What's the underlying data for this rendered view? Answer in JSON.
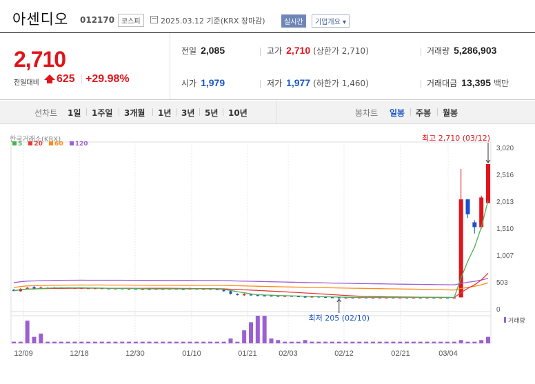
{
  "header": {
    "name": "아센디오",
    "code": "012170",
    "market": "코스피",
    "base_date": "2025.03.12  기준(KRX 장마감)",
    "realtime_label": "실시간",
    "corp_label": "기업개요 ▾"
  },
  "summary": {
    "price": "2,710",
    "change_label": "전일대비",
    "change_amount": "625",
    "change_pct": "+29.98%",
    "prev_close_label": "전일",
    "prev_close": "2,085",
    "high_label": "고가",
    "high": "2,710",
    "upper_limit": "(상한가 2,710)",
    "volume_label": "거래량",
    "volume": "5,286,903",
    "open_label": "시가",
    "open": "1,979",
    "low_label": "저가",
    "low": "1,977",
    "lower_limit": "(하한가 1,460)",
    "amount_label": "거래대금",
    "amount": "13,395",
    "amount_unit": "백만"
  },
  "period_bar": {
    "line_label": "선차트",
    "line_periods": [
      "1일",
      "1주일",
      "3개월",
      "1년",
      "3년",
      "5년",
      "10년"
    ],
    "candle_label": "봉차트",
    "candle_periods": [
      "일봉",
      "주봉",
      "월봉"
    ]
  },
  "colors": {
    "up": "#e0151b",
    "down": "#1a54c8",
    "ma5": "#4caf50",
    "ma20": "#e53935",
    "ma60": "#ff8c1a",
    "ma120": "#9c5fd1"
  },
  "chart_data": {
    "type": "candlestick",
    "source": "한국거래소(KRX)",
    "legend": [
      {
        "name": "5",
        "color": "#4caf50"
      },
      {
        "name": "20",
        "color": "#e53935"
      },
      {
        "name": "60",
        "color": "#ff8c1a"
      },
      {
        "name": "120",
        "color": "#9c5fd1"
      }
    ],
    "price_ticks": [
      "3,020",
      "2,516",
      "2,013",
      "1,510",
      "1,007",
      "503",
      "0"
    ],
    "ylim": [
      0,
      3020
    ],
    "x_ticks": [
      "12/09",
      "12/18",
      "12/30",
      "01/10",
      "01/21",
      "02/03",
      "02/12",
      "02/21",
      "03/04"
    ],
    "max_annotation": "최고 2,710 (03/12)",
    "min_annotation": "최저 205 (02/10)",
    "volume_label": "거래량",
    "candles": [
      {
        "o": 355,
        "c": 340,
        "h": 375,
        "l": 330
      },
      {
        "o": 330,
        "c": 375,
        "h": 385,
        "l": 320
      },
      {
        "o": 380,
        "c": 395,
        "h": 410,
        "l": 370
      },
      {
        "o": 410,
        "c": 380,
        "h": 440,
        "l": 370
      },
      {
        "o": 395,
        "c": 400,
        "h": 420,
        "l": 390
      },
      {
        "o": 395,
        "c": 385,
        "h": 405,
        "l": 375
      },
      {
        "o": 395,
        "c": 400,
        "h": 410,
        "l": 385
      },
      {
        "o": 400,
        "c": 395,
        "h": 410,
        "l": 390
      },
      {
        "o": 400,
        "c": 395,
        "h": 405,
        "l": 390
      },
      {
        "o": 395,
        "c": 390,
        "h": 400,
        "l": 385
      },
      {
        "o": 385,
        "c": 395,
        "h": 400,
        "l": 380
      },
      {
        "o": 390,
        "c": 380,
        "h": 395,
        "l": 375
      },
      {
        "o": 385,
        "c": 390,
        "h": 395,
        "l": 380
      },
      {
        "o": 390,
        "c": 385,
        "h": 395,
        "l": 380
      },
      {
        "o": 385,
        "c": 380,
        "h": 390,
        "l": 375
      },
      {
        "o": 380,
        "c": 385,
        "h": 390,
        "l": 375
      },
      {
        "o": 385,
        "c": 375,
        "h": 390,
        "l": 370
      },
      {
        "o": 375,
        "c": 380,
        "h": 385,
        "l": 370
      },
      {
        "o": 380,
        "c": 370,
        "h": 385,
        "l": 365
      },
      {
        "o": 370,
        "c": 375,
        "h": 380,
        "l": 365
      },
      {
        "o": 375,
        "c": 370,
        "h": 380,
        "l": 365
      },
      {
        "o": 370,
        "c": 378,
        "h": 385,
        "l": 365
      },
      {
        "o": 378,
        "c": 372,
        "h": 382,
        "l": 368
      },
      {
        "o": 372,
        "c": 380,
        "h": 385,
        "l": 368
      },
      {
        "o": 380,
        "c": 374,
        "h": 385,
        "l": 370
      },
      {
        "o": 374,
        "c": 368,
        "h": 378,
        "l": 364
      },
      {
        "o": 368,
        "c": 380,
        "h": 400,
        "l": 365
      },
      {
        "o": 380,
        "c": 370,
        "h": 385,
        "l": 365
      },
      {
        "o": 370,
        "c": 378,
        "h": 385,
        "l": 365
      },
      {
        "o": 378,
        "c": 372,
        "h": 382,
        "l": 366
      },
      {
        "o": 372,
        "c": 365,
        "h": 378,
        "l": 360
      },
      {
        "o": 365,
        "c": 330,
        "h": 368,
        "l": 320
      },
      {
        "o": 330,
        "c": 280,
        "h": 345,
        "l": 270
      },
      {
        "o": 280,
        "c": 260,
        "h": 290,
        "l": 250
      },
      {
        "o": 255,
        "c": 275,
        "h": 300,
        "l": 240
      },
      {
        "o": 270,
        "c": 258,
        "h": 280,
        "l": 250
      },
      {
        "o": 258,
        "c": 252,
        "h": 262,
        "l": 246
      },
      {
        "o": 252,
        "c": 250,
        "h": 258,
        "l": 244
      },
      {
        "o": 250,
        "c": 246,
        "h": 256,
        "l": 240
      },
      {
        "o": 246,
        "c": 240,
        "h": 252,
        "l": 236
      },
      {
        "o": 240,
        "c": 245,
        "h": 250,
        "l": 235
      },
      {
        "o": 245,
        "c": 238,
        "h": 248,
        "l": 232
      },
      {
        "o": 238,
        "c": 230,
        "h": 242,
        "l": 226
      },
      {
        "o": 230,
        "c": 226,
        "h": 236,
        "l": 222
      },
      {
        "o": 226,
        "c": 232,
        "h": 238,
        "l": 222
      },
      {
        "o": 232,
        "c": 225,
        "h": 235,
        "l": 220
      },
      {
        "o": 225,
        "c": 220,
        "h": 230,
        "l": 216
      },
      {
        "o": 220,
        "c": 215,
        "h": 224,
        "l": 210
      },
      {
        "o": 215,
        "c": 210,
        "h": 220,
        "l": 205
      },
      {
        "o": 210,
        "c": 215,
        "h": 220,
        "l": 205
      },
      {
        "o": 215,
        "c": 212,
        "h": 218,
        "l": 208
      },
      {
        "o": 212,
        "c": 216,
        "h": 220,
        "l": 208
      },
      {
        "o": 216,
        "c": 212,
        "h": 220,
        "l": 208
      },
      {
        "o": 212,
        "c": 214,
        "h": 218,
        "l": 208
      },
      {
        "o": 214,
        "c": 212,
        "h": 218,
        "l": 208
      },
      {
        "o": 212,
        "c": 215,
        "h": 220,
        "l": 208
      },
      {
        "o": 215,
        "c": 212,
        "h": 218,
        "l": 208
      },
      {
        "o": 212,
        "c": 214,
        "h": 218,
        "l": 208
      },
      {
        "o": 214,
        "c": 212,
        "h": 218,
        "l": 208
      },
      {
        "o": 212,
        "c": 214,
        "h": 218,
        "l": 208
      },
      {
        "o": 214,
        "c": 212,
        "h": 218,
        "l": 208
      },
      {
        "o": 212,
        "c": 214,
        "h": 218,
        "l": 208
      },
      {
        "o": 214,
        "c": 212,
        "h": 218,
        "l": 208
      },
      {
        "o": 212,
        "c": 214,
        "h": 218,
        "l": 208
      },
      {
        "o": 214,
        "c": 212,
        "h": 218,
        "l": 208
      },
      {
        "o": 212,
        "c": 214,
        "h": 218,
        "l": 208
      },
      {
        "o": 214,
        "c": 2050,
        "h": 2620,
        "l": 1620
      },
      {
        "o": 2050,
        "c": 1770,
        "h": 2050,
        "l": 1700
      },
      {
        "o": 1620,
        "c": 1530,
        "h": 1660,
        "l": 1410
      },
      {
        "o": 1530,
        "c": 2085,
        "h": 2120,
        "l": 1500
      },
      {
        "o": 1979,
        "c": 2710,
        "h": 2710,
        "l": 1977
      }
    ],
    "volume": [
      1,
      1,
      14,
      4,
      6,
      1,
      1,
      1,
      1,
      1,
      1,
      1,
      1,
      1,
      1,
      1,
      1,
      1,
      1,
      1,
      1,
      1,
      1,
      1,
      1,
      1,
      1,
      1,
      1,
      1,
      1,
      1,
      3,
      1,
      8,
      13,
      17,
      17,
      3,
      2,
      1,
      1,
      1,
      2,
      1,
      1,
      1,
      1,
      1,
      1,
      1,
      1,
      1,
      1,
      1,
      1,
      1,
      1,
      1,
      1,
      1,
      1,
      1,
      1,
      1,
      1,
      2,
      1,
      1,
      2,
      4
    ]
  }
}
